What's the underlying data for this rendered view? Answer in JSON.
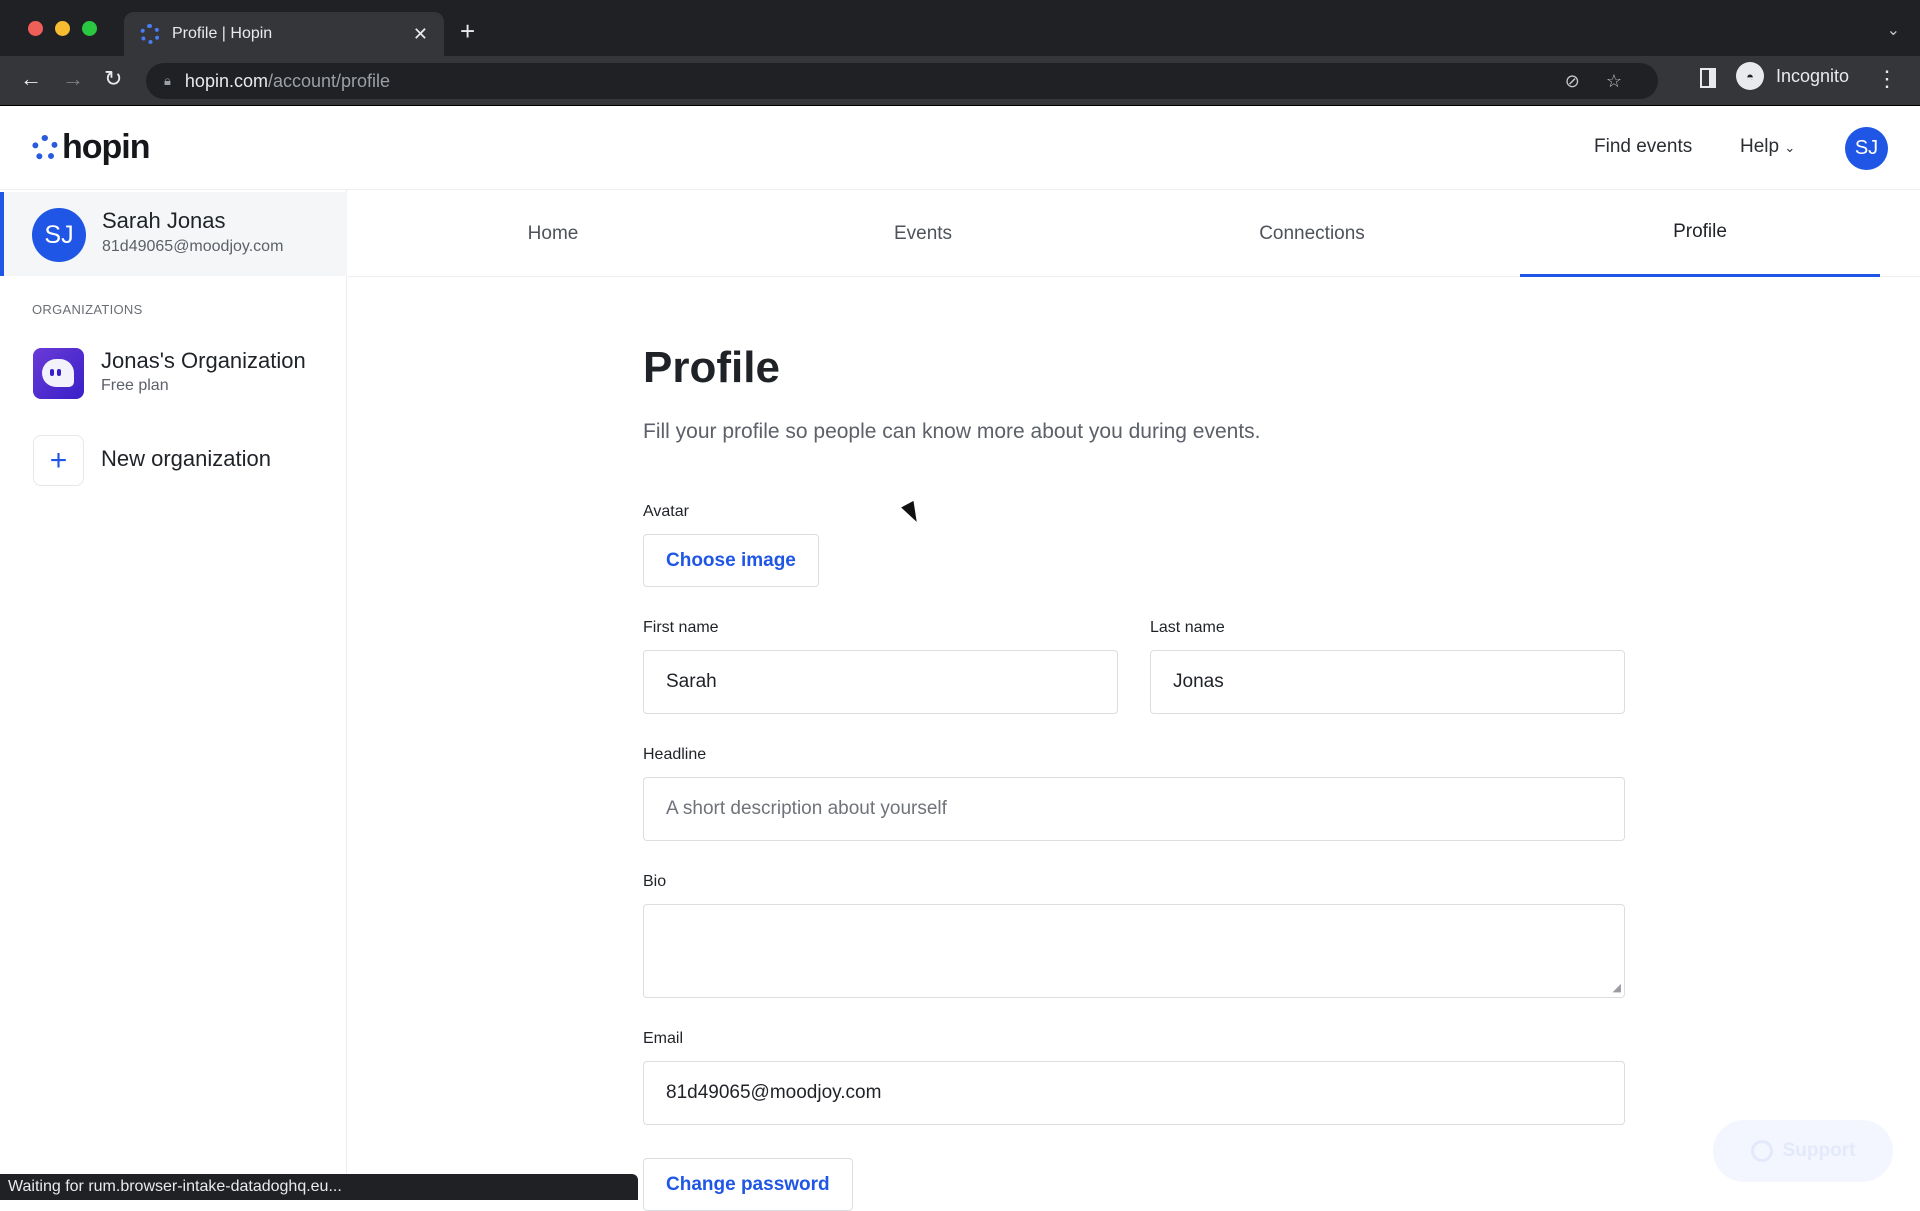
{
  "browser": {
    "tab_title": "Profile | Hopin",
    "url_host": "hopin.com",
    "url_path": "/account/profile",
    "profile_label": "Incognito",
    "status_text": "Waiting for rum.browser-intake-datadoghq.eu..."
  },
  "header": {
    "logo": "hopin",
    "links": [
      "Find events",
      "Help"
    ],
    "avatar_initials": "SJ"
  },
  "sidebar": {
    "user": {
      "initials": "SJ",
      "name": "Sarah Jonas",
      "email": "81d49065@moodjoy.com"
    },
    "organizations_heading": "ORGANIZATIONS",
    "organizations": [
      {
        "name": "Jonas's Organization",
        "plan": "Free plan"
      }
    ],
    "new_org_label": "New organization"
  },
  "tabs": [
    {
      "label": "Home",
      "active": false
    },
    {
      "label": "Events",
      "active": false
    },
    {
      "label": "Connections",
      "active": false
    },
    {
      "label": "Profile",
      "active": true
    }
  ],
  "form": {
    "title": "Profile",
    "subtitle": "Fill your profile so people can know more about you during events.",
    "avatar_label": "Avatar",
    "choose_image": "Choose image",
    "first_name_label": "First name",
    "first_name_value": "Sarah",
    "last_name_label": "Last name",
    "last_name_value": "Jonas",
    "headline_label": "Headline",
    "headline_placeholder": "A short description about yourself",
    "bio_label": "Bio",
    "bio_value": "",
    "email_label": "Email",
    "email_value": "81d49065@moodjoy.com",
    "change_password": "Change password"
  },
  "support_label": "Support",
  "colors": {
    "accent": "#1f56e6",
    "org_icon": "#3820c8"
  }
}
